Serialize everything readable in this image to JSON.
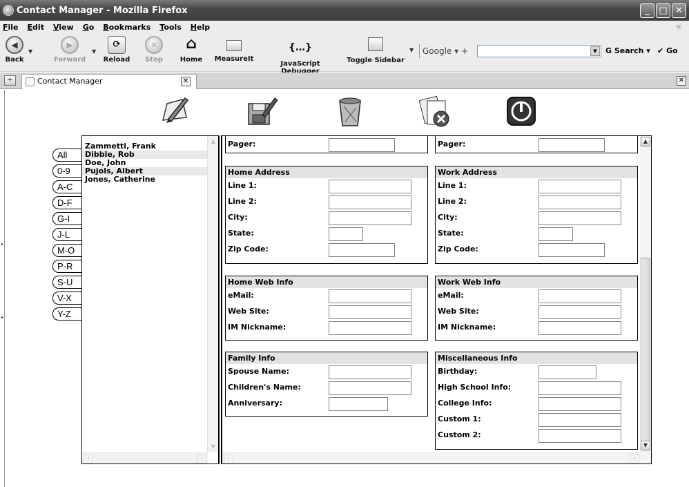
{
  "window": {
    "title": "Contact Manager - Mozilla Firefox"
  },
  "menu": {
    "items": [
      {
        "pre": "",
        "u": "F",
        "post": "ile"
      },
      {
        "pre": "",
        "u": "E",
        "post": "dit"
      },
      {
        "pre": "",
        "u": "V",
        "post": "iew"
      },
      {
        "pre": "",
        "u": "G",
        "post": "o"
      },
      {
        "pre": "",
        "u": "B",
        "post": "ookmarks"
      },
      {
        "pre": "",
        "u": "T",
        "post": "ools"
      },
      {
        "pre": "",
        "u": "H",
        "post": "elp"
      }
    ]
  },
  "toolbar": {
    "back": "Back",
    "forward": "Forward",
    "reload": "Reload",
    "stop": "Stop",
    "home": "Home",
    "measureit": "MeasureIt",
    "js_debugger": "JavaScript Debugger",
    "toggle_sidebar": "Toggle Sidebar",
    "search_engine": "Google",
    "search_button": "Search",
    "go_button": "Go"
  },
  "tabs": [
    {
      "label": "Contact Manager"
    }
  ],
  "app_icons": [
    "new-contact-icon",
    "save-contact-icon",
    "delete-contact-icon",
    "clear-all-icon",
    "exit-icon"
  ],
  "letter_tabs": [
    "All",
    "0-9",
    "A-C",
    "D-F",
    "G-I",
    "J-L",
    "M-O",
    "P-R",
    "S-U",
    "V-X",
    "Y-Z"
  ],
  "contacts": [
    "Zammetti, Frank",
    "Dibble, Rob",
    "Doe, John",
    "Pujols, Albert",
    "Jones, Catherine"
  ],
  "form": {
    "pager_left": "Pager:",
    "pager_right": "Pager:",
    "home_address": {
      "title": "Home Address",
      "fields": [
        "Line 1:",
        "Line 2:",
        "City:",
        "State:",
        "Zip Code:"
      ]
    },
    "work_address": {
      "title": "Work Address",
      "fields": [
        "Line 1:",
        "Line 2:",
        "City:",
        "State:",
        "Zip Code:"
      ]
    },
    "home_web": {
      "title": "Home Web Info",
      "fields": [
        "eMail:",
        "Web Site:",
        "IM Nickname:"
      ]
    },
    "work_web": {
      "title": "Work Web Info",
      "fields": [
        "eMail:",
        "Web Site:",
        "IM Nickname:"
      ]
    },
    "family": {
      "title": "Family Info",
      "fields": [
        "Spouse Name:",
        "Children's Name:",
        "Anniversary:"
      ]
    },
    "misc": {
      "title": "Miscellaneous Info",
      "fields": [
        "Birthday:",
        "High School Info:",
        "College Info:",
        "Custom 1:",
        "Custom 2:"
      ]
    }
  }
}
